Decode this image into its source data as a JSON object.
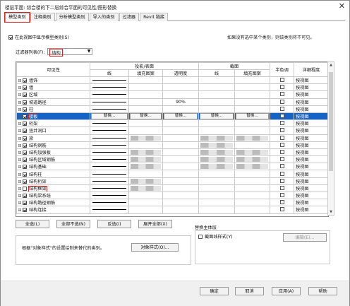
{
  "title": "楼层平面: 综合楼的下二层综合平面的可见性/图形替换",
  "close_glyph": "✕",
  "tabs": [
    "模型类别",
    "注释类别",
    "分析模型类别",
    "导入的类别",
    "过滤器",
    "Revit 链接"
  ],
  "show_categories_label": "在此视图中显示模型类别(S)",
  "hint": "如果没有选中某个类别，则该类别将不可见。",
  "filter_label": "过滤器列表(F):",
  "filter_value": "结构",
  "columns": {
    "visibility": "可见性",
    "projection_surface": "投影/表面",
    "cut": "截面",
    "halftone": "半色调",
    "detail_level": "详细程度",
    "lines": "线",
    "patterns": "填充图案",
    "transparency": "透明度"
  },
  "override_label": "替换...",
  "rows": [
    {
      "name": "墙饰",
      "checked": true,
      "expand": true,
      "proj_line": true,
      "proj_pattern": "",
      "trans": "",
      "cut_line": "",
      "cut_pattern": "",
      "detail": "按视图"
    },
    {
      "name": "墙",
      "checked": true,
      "expand": true,
      "proj_line": true,
      "proj_pattern": "",
      "trans": "",
      "cut_line": "",
      "cut_pattern": "",
      "detail": "按视图"
    },
    {
      "name": "区域",
      "checked": true,
      "expand": true,
      "proj_line": true,
      "proj_pattern": "",
      "trans": "",
      "cut_line": "",
      "cut_pattern": "",
      "detail": "按视图"
    },
    {
      "name": "坡道路径",
      "checked": true,
      "expand": true,
      "proj_line": true,
      "proj_pattern": "",
      "trans": "90%",
      "cut_line": "",
      "cut_pattern": "",
      "detail": "按视图"
    },
    {
      "name": "柱",
      "checked": true,
      "expand": true,
      "proj_line": true,
      "proj_pattern": "",
      "trans": "",
      "cut_line": "",
      "cut_pattern": "",
      "detail": "按视图"
    },
    {
      "name": "楼板",
      "checked": true,
      "expand": true,
      "selected": true,
      "detail": "按视图"
    },
    {
      "name": "桁架",
      "checked": true,
      "expand": true,
      "proj_line": true,
      "proj_pattern": "",
      "trans": "",
      "cut_line": "",
      "cut_pattern": "",
      "detail": "按视图"
    },
    {
      "name": "竖井洞口",
      "checked": true,
      "expand": true,
      "proj_line": true,
      "proj_pattern": "",
      "trans": "",
      "cut_line": "",
      "cut_pattern": "",
      "detail": "按视图"
    },
    {
      "name": "梁",
      "checked": true,
      "expand": true,
      "proj_line": true,
      "proj_pattern": "hatch",
      "trans": "",
      "cut_line": "hatch",
      "cut_pattern": "hatch",
      "detail": "按视图"
    },
    {
      "name": "结构钢筋",
      "checked": true,
      "expand": true,
      "proj_line": true,
      "proj_pattern": "",
      "trans": "",
      "cut_line": "hatch",
      "cut_pattern": "",
      "detail": "按视图"
    },
    {
      "name": "结构加强板",
      "checked": true,
      "expand": true,
      "proj_line": true,
      "proj_pattern": "hatch",
      "trans": "",
      "cut_line": "hatch",
      "cut_pattern": "hatch",
      "detail": "按视图"
    },
    {
      "name": "结构区域钢筋",
      "checked": true,
      "expand": true,
      "proj_line": true,
      "proj_pattern": "hatch",
      "trans": "",
      "cut_line": "hatch",
      "cut_pattern": "hatch",
      "detail": "按视图"
    },
    {
      "name": "结构基础",
      "checked": true,
      "expand": true,
      "proj_line": true,
      "proj_pattern": "hatch",
      "trans": "",
      "cut_line": "hatch",
      "cut_pattern": "hatch",
      "detail": "按视图"
    },
    {
      "name": "结构柱",
      "checked": true,
      "expand": true,
      "proj_line": true,
      "proj_pattern": "",
      "trans": "",
      "cut_line": "",
      "cut_pattern": "",
      "detail": "按视图"
    },
    {
      "name": "结构桁架",
      "checked": true,
      "expand": true,
      "proj_line": true,
      "proj_pattern": "hatch",
      "trans": "",
      "cut_line": "",
      "cut_pattern": "",
      "detail": "按视图"
    },
    {
      "name": "结构框架",
      "checked": false,
      "expand": true,
      "proj_line": true,
      "proj_pattern": "hatch",
      "trans": "",
      "cut_line": "",
      "cut_pattern": "",
      "detail": "按视图"
    },
    {
      "name": "结构梁系统",
      "checked": true,
      "expand": true,
      "proj_line": true,
      "proj_pattern": "",
      "trans": "",
      "cut_line": "",
      "cut_pattern": "",
      "detail": "按视图"
    },
    {
      "name": "结构路径钢筋",
      "checked": true,
      "expand": true,
      "proj_line": true,
      "proj_pattern": "",
      "trans": "",
      "cut_line": "",
      "cut_pattern": "",
      "detail": "按视图"
    },
    {
      "name": "结构连接",
      "checked": true,
      "expand": true,
      "proj_line": true,
      "proj_pattern": "",
      "trans": "",
      "cut_line": "",
      "cut_pattern": "",
      "detail": "按视图"
    }
  ],
  "buttons": {
    "all": "全选(L)",
    "none": "全部不选(N)",
    "invert": "反选(I)",
    "expand_all": "展开全部(X)"
  },
  "object_styles_hint": "根据\"对象样式\"的设置绘制未替代的类别。",
  "object_styles_btn": "对象样式(O)...",
  "subcategory_label": "替换主体层",
  "cut_line_styles": "截面线样式(Y)",
  "edit_btn": "编辑(E)...",
  "footer": {
    "ok": "确定",
    "cancel": "取消",
    "apply": "应用(A)",
    "help": "帮助"
  }
}
